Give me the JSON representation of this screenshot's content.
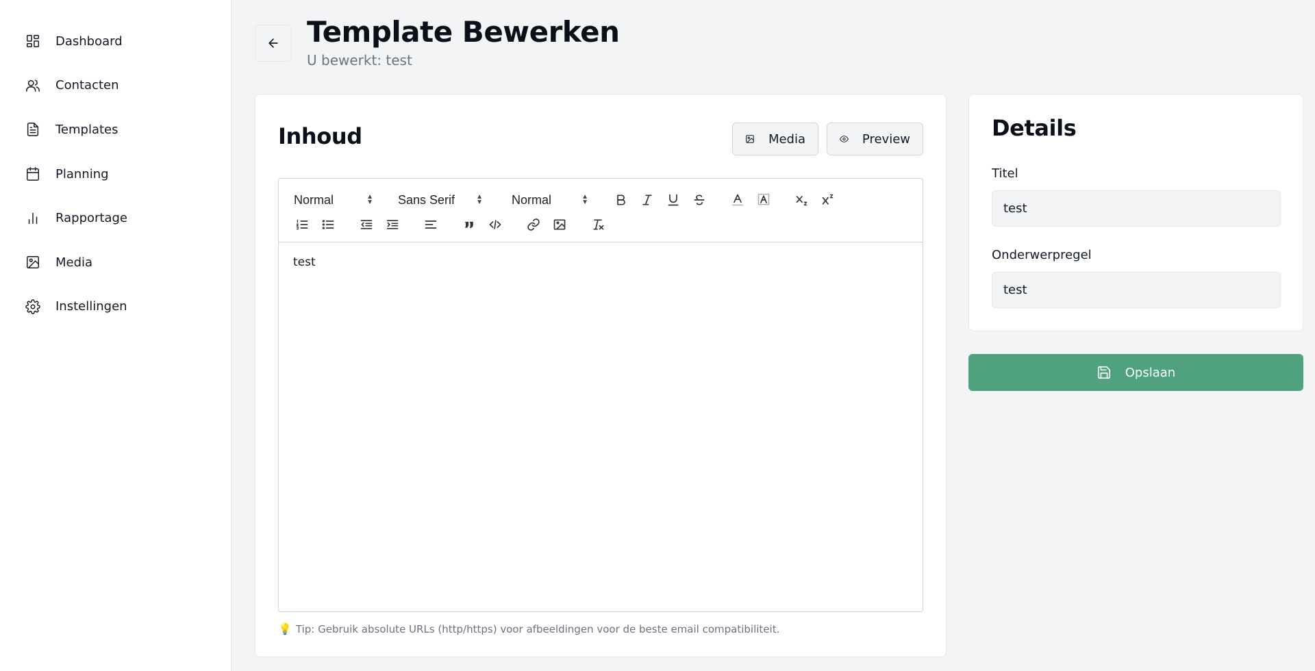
{
  "sidebar": {
    "items": [
      {
        "label": "Dashboard",
        "icon": "dashboard-icon"
      },
      {
        "label": "Contacten",
        "icon": "users-icon"
      },
      {
        "label": "Templates",
        "icon": "file-text-icon"
      },
      {
        "label": "Planning",
        "icon": "calendar-icon"
      },
      {
        "label": "Rapportage",
        "icon": "bar-chart-icon"
      },
      {
        "label": "Media",
        "icon": "image-icon"
      },
      {
        "label": "Instellingen",
        "icon": "gear-icon"
      }
    ]
  },
  "header": {
    "title": "Template Bewerken",
    "subtitle": "U bewerkt: test",
    "back_icon": "arrow-left-icon"
  },
  "content": {
    "title": "Inhoud",
    "media_label": "Media",
    "preview_label": "Preview",
    "toolbar": {
      "heading_select": "Normal",
      "font_select": "Sans Serif",
      "size_select": "Normal"
    },
    "body_text": "test",
    "tip": "Tip: Gebruik absolute URLs (http/https) voor afbeeldingen voor de beste email compatibiliteit.",
    "tip_icon": "💡"
  },
  "details": {
    "title": "Details",
    "title_label": "Titel",
    "title_value": "test",
    "subject_label": "Onderwerpregel",
    "subject_value": "test"
  },
  "save_label": "Opslaan",
  "colors": {
    "accent": "#4ea37e",
    "background": "#f3f4f6",
    "text": "#111827",
    "muted": "#6b7280"
  }
}
